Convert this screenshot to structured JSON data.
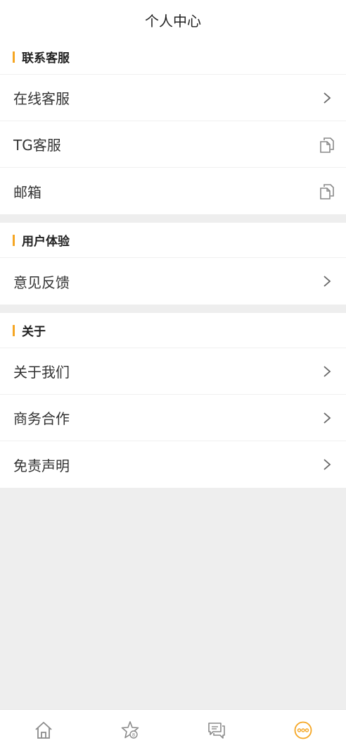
{
  "header": {
    "title": "个人中心"
  },
  "sections": [
    {
      "title": "联系客服",
      "items": [
        {
          "label": "在线客服",
          "icon": "chevron-right-icon"
        },
        {
          "label": "TG客服",
          "icon": "copy-icon"
        },
        {
          "label": "邮箱",
          "icon": "copy-icon"
        }
      ]
    },
    {
      "title": "用户体验",
      "items": [
        {
          "label": "意见反馈",
          "icon": "chevron-right-icon"
        }
      ]
    },
    {
      "title": "关于",
      "items": [
        {
          "label": "关于我们",
          "icon": "chevron-right-icon"
        },
        {
          "label": "商务合作",
          "icon": "chevron-right-icon"
        },
        {
          "label": "免责声明",
          "icon": "chevron-right-icon"
        }
      ]
    }
  ],
  "tabbar": {
    "tabs": [
      {
        "icon": "home-icon",
        "active": false
      },
      {
        "icon": "star-badge-icon",
        "active": false
      },
      {
        "icon": "chat-icon",
        "active": false
      },
      {
        "icon": "more-icon",
        "active": true
      }
    ],
    "active_color": "#f5a623",
    "inactive_color": "#8a8a8a"
  },
  "colors": {
    "accent": "#f5a623",
    "background": "#eeeeee"
  }
}
